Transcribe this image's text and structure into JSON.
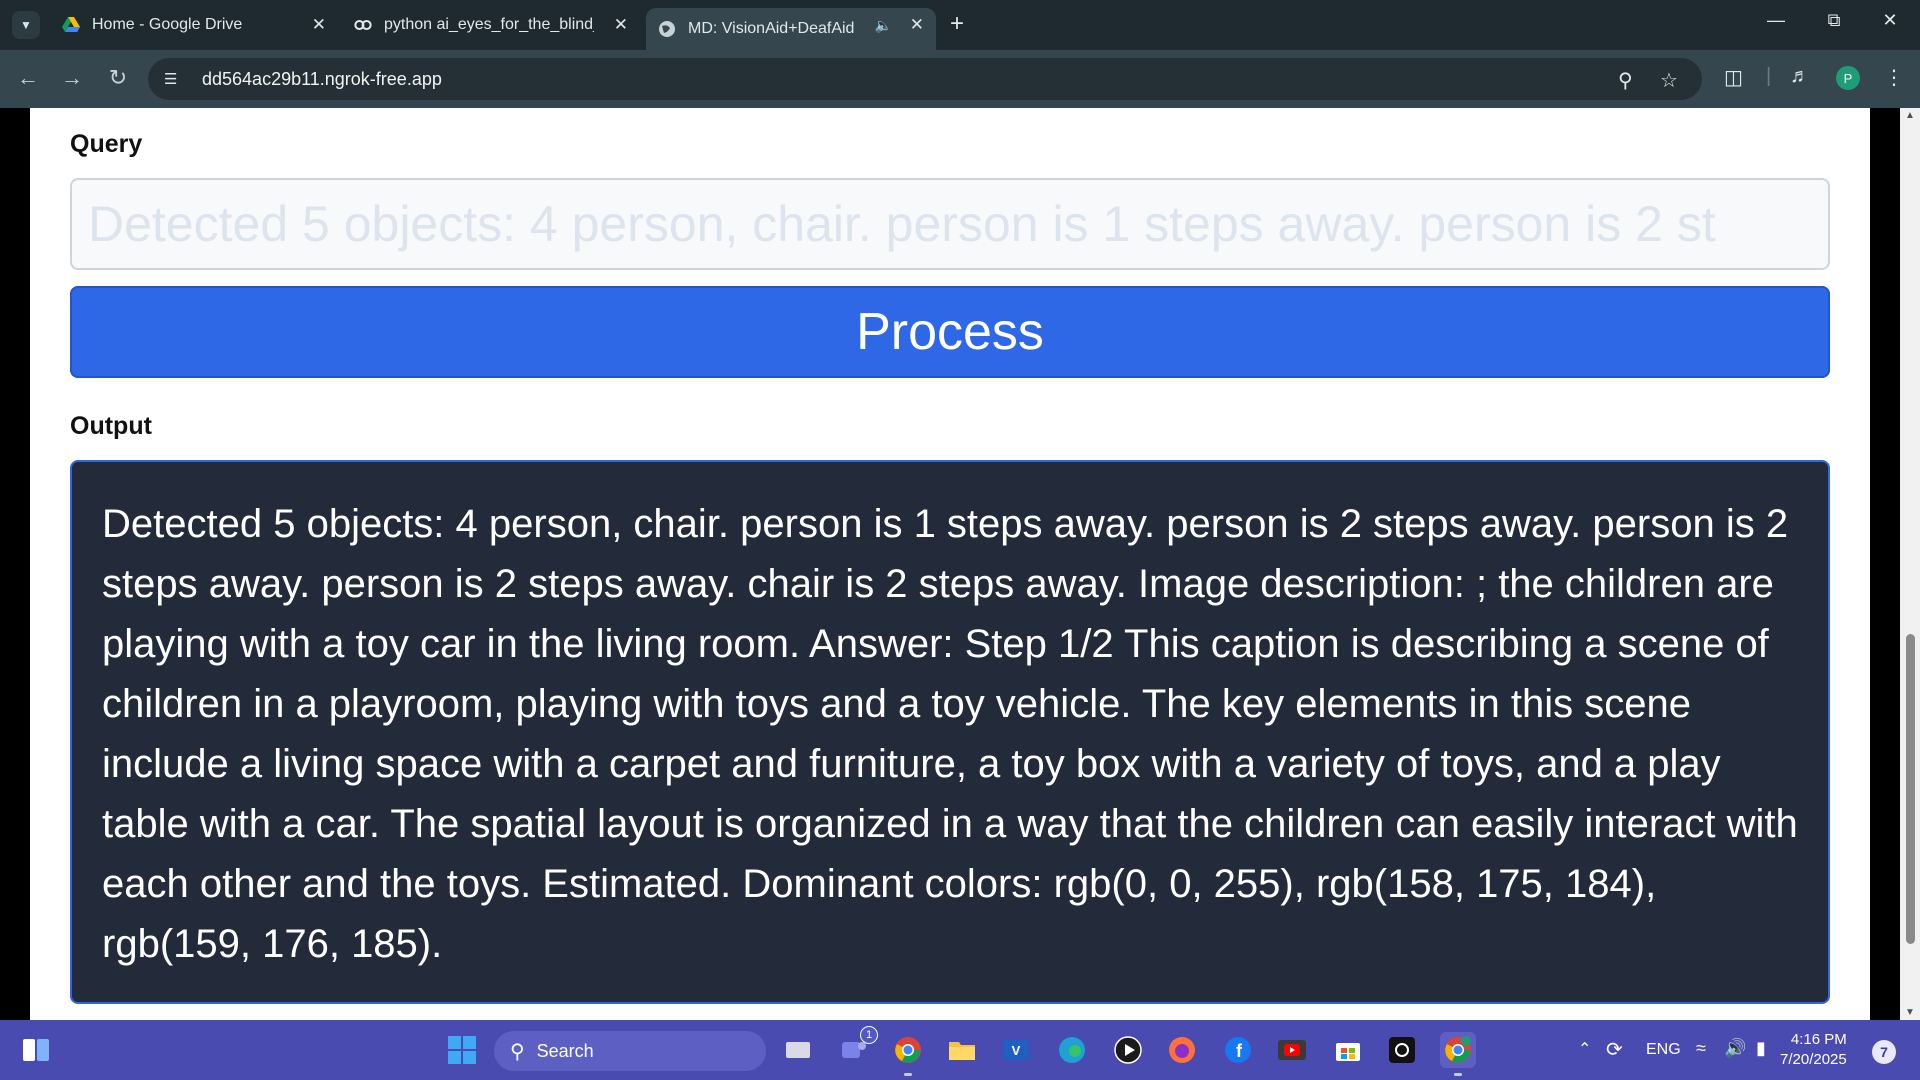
{
  "browser": {
    "tabs": [
      {
        "title": "Home - Google Drive",
        "icon": "google-drive-icon"
      },
      {
        "title": "python ai_eyes_for_the_blind_g",
        "icon": "colab-icon"
      },
      {
        "title": "MD: VisionAid+DeafAid",
        "icon": "globe-icon",
        "active": true
      }
    ],
    "url": "dd564ac29b11.ngrok-free.app",
    "profile_initial": "P"
  },
  "app": {
    "query_label": "Query",
    "query_placeholder": "Detected 5 objects: 4 person, chair. person is 1 steps away. person is 2 st",
    "process_label": "Process",
    "output_label": "Output",
    "output_text": "Detected 5 objects: 4 person, chair. person is 1 steps away. person is 2 steps away. person is 2 steps away. person is 2 steps away. chair is 2 steps away. Image description: ; the children are playing with a toy car in the living room. Answer: Step 1/2 This caption is describing a scene of children in a playroom, playing with toys and a toy vehicle. The key elements in this scene include a living space with a carpet and furniture, a toy box with a variety of toys, and a play table with a car. The spatial layout is organized in a way that the children can easily interact with each other and the toys. Estimated. Dominant colors: rgb(0, 0, 255), rgb(158, 175, 184), rgb(159, 176, 185)."
  },
  "taskbar": {
    "search_label": "Search",
    "language": "ENG",
    "time": "4:16 PM",
    "date": "7/20/2025",
    "notification_count": "7",
    "teams_badge": "1"
  },
  "colors": {
    "accent": "#2e68e6",
    "output_bg": "#232b3b",
    "taskbar": "#4a4bb0",
    "browser_frame": "#35464f"
  }
}
